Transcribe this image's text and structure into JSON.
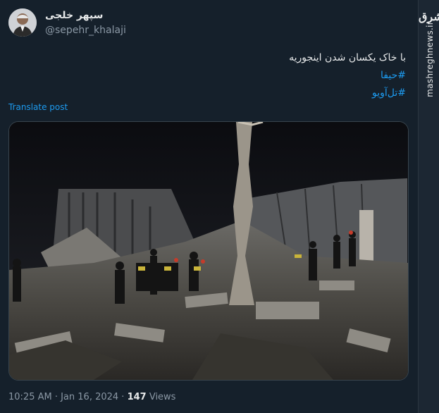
{
  "author": {
    "display_name": "سپهر خلجی",
    "handle": "@sepehr_khalaji"
  },
  "tweet": {
    "text": "با خاک یکسان شدن اینجوریه",
    "hashtags": [
      "#حیفا",
      "#تل‌آویو"
    ],
    "translate_label": "Translate post",
    "timestamp": "10:25 AM · Jan 16, 2024 · ",
    "views_count": "147",
    "views_label": " Views"
  },
  "watermark": {
    "logo": "مشرق",
    "url": "mashreghnews.ir"
  },
  "colors": {
    "background": "#15202b",
    "link": "#1d9bf0",
    "secondary_text": "#8b98a5"
  }
}
